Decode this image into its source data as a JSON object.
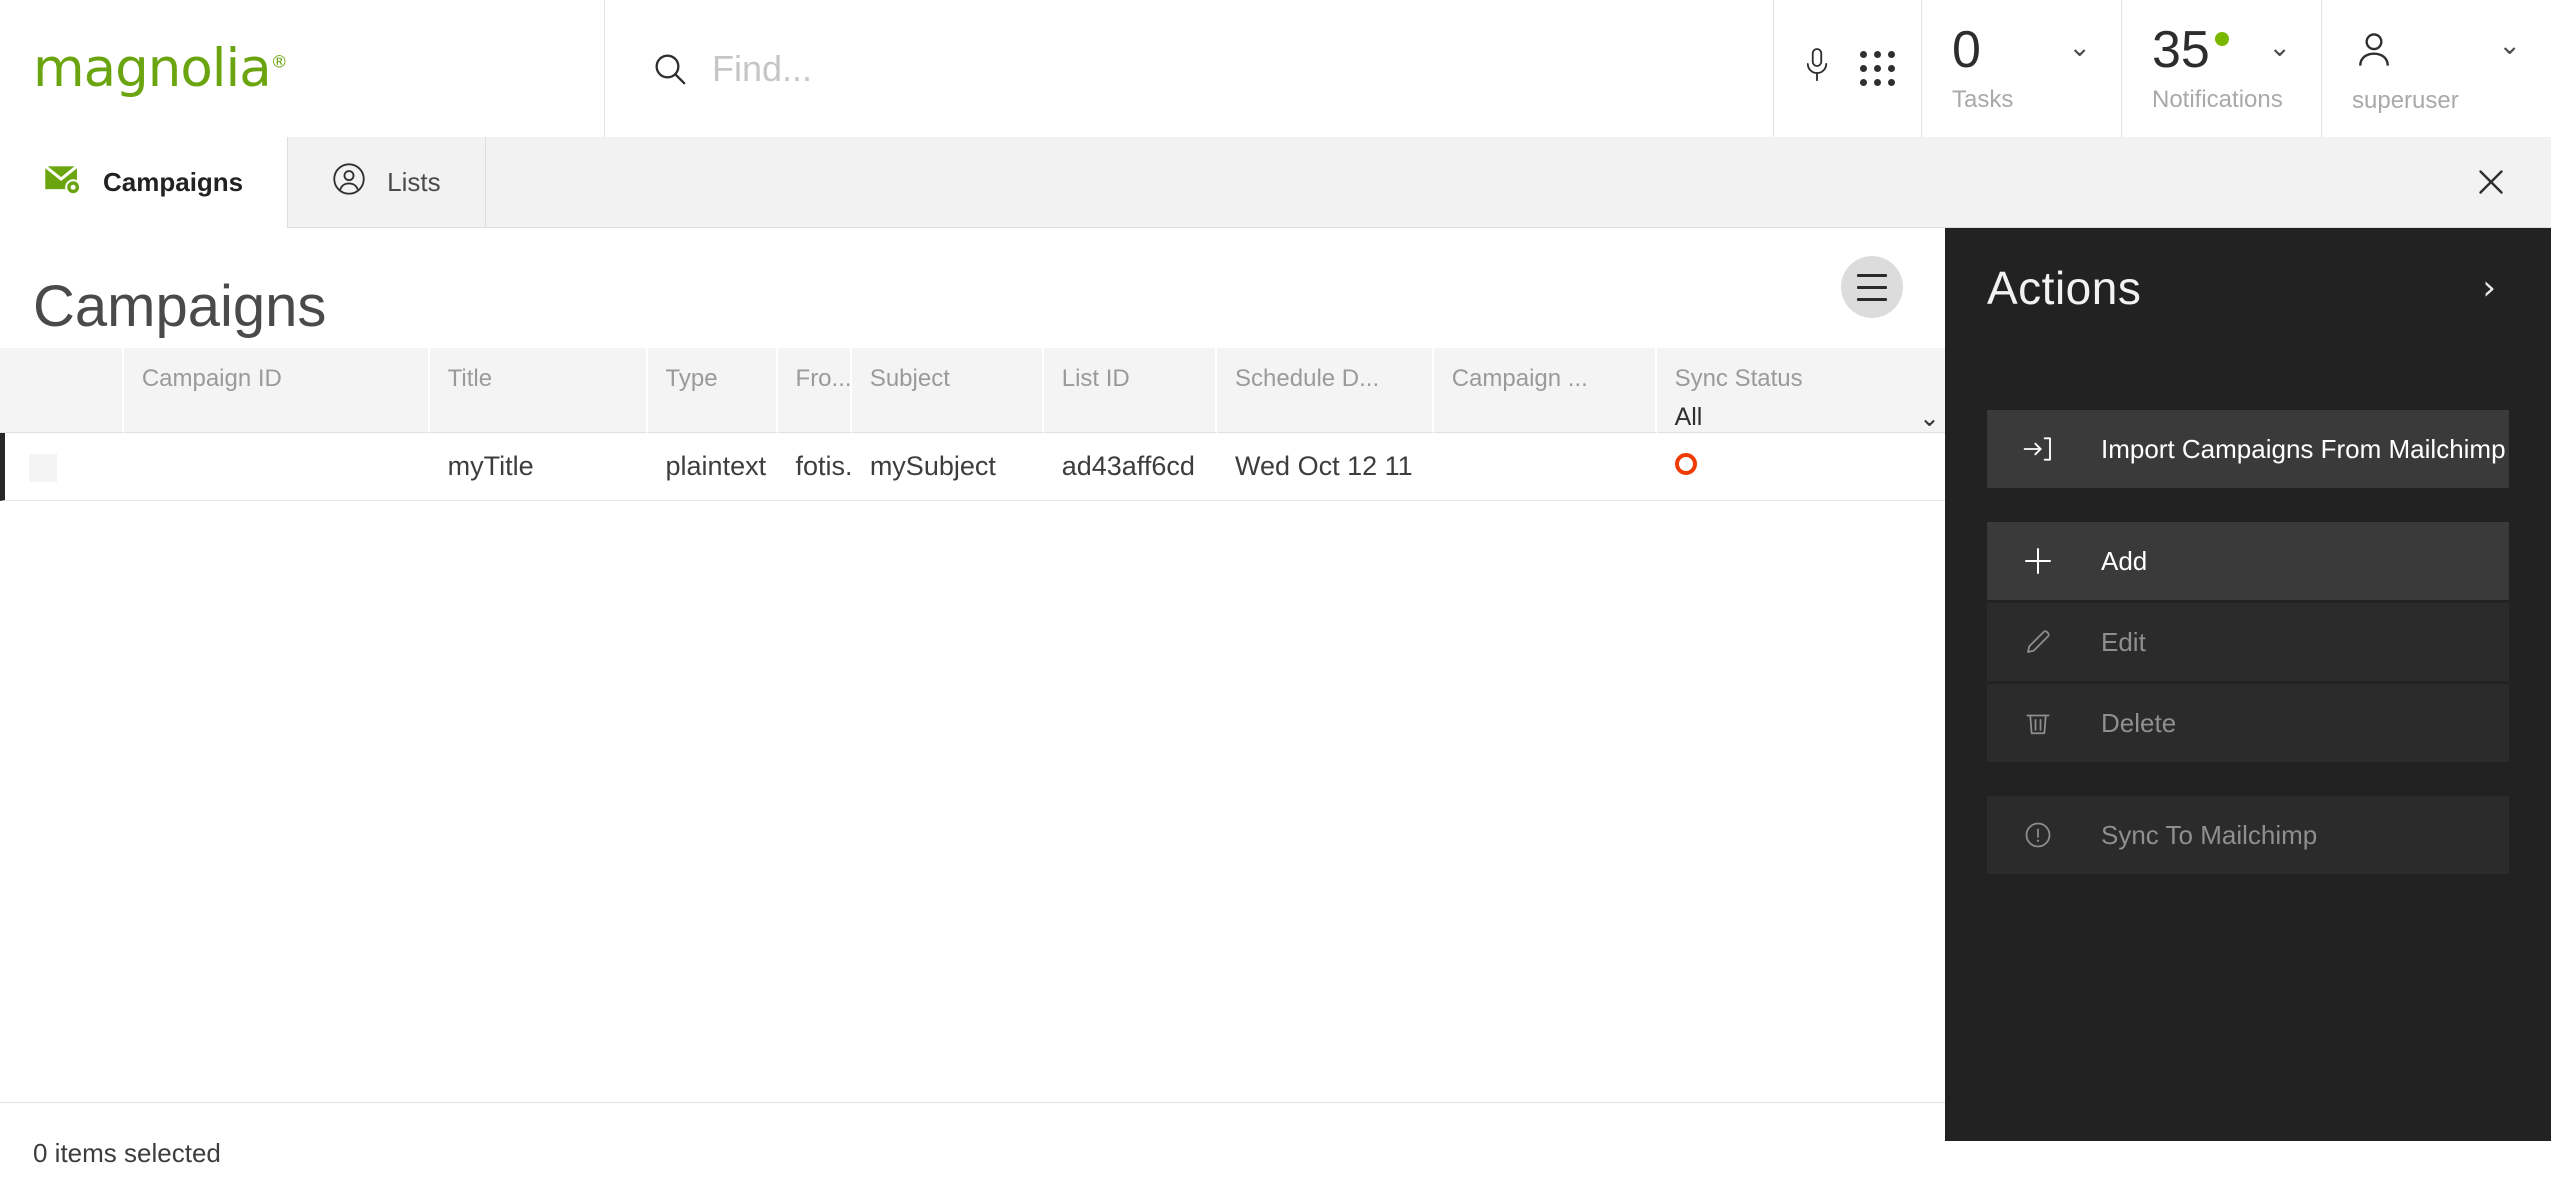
{
  "brand": {
    "name": "magnolia",
    "registered": "®",
    "color": "#6aa50f"
  },
  "search": {
    "placeholder": "Find...",
    "icon": "search-icon"
  },
  "header": {
    "mic_icon": "microphone-icon",
    "apps_icon": "apps-grid-icon",
    "tasks": {
      "count": "0",
      "label": "Tasks",
      "chevron": "⌄"
    },
    "notifications": {
      "count": "35",
      "label": "Notifications",
      "chevron": "⌄",
      "dot_color": "#7ab800"
    },
    "user": {
      "name": "superuser",
      "icon": "user-icon",
      "chevron": "⌄"
    }
  },
  "tabs": [
    {
      "label": "Campaigns",
      "icon": "mail-gear-icon",
      "active": true
    },
    {
      "label": "Lists",
      "icon": "user-circle-icon",
      "active": false
    }
  ],
  "tabbar": {
    "close_icon": "close-icon"
  },
  "page": {
    "title": "Campaigns",
    "viewmode_icon": "hamburger-icon"
  },
  "table": {
    "columns": [
      {
        "key": "check",
        "label": ""
      },
      {
        "key": "campaign_id",
        "label": "Campaign ID"
      },
      {
        "key": "title",
        "label": "Title"
      },
      {
        "key": "type",
        "label": "Type"
      },
      {
        "key": "from",
        "label": "Fro..."
      },
      {
        "key": "subject",
        "label": "Subject"
      },
      {
        "key": "list_id",
        "label": "List ID"
      },
      {
        "key": "schedule_date",
        "label": "Schedule D..."
      },
      {
        "key": "campaign_x",
        "label": "Campaign ..."
      },
      {
        "key": "sync_status",
        "label": "Sync Status"
      }
    ],
    "sync_status_filter": {
      "value": "All",
      "chevron": "⌄"
    },
    "rows": [
      {
        "check": "",
        "campaign_id": "",
        "title": "myTitle",
        "type": "plaintext",
        "from": "fotis.flc",
        "subject": "mySubject",
        "list_id": "ad43aff6cd",
        "schedule_date": "Wed Oct 12 11",
        "campaign_x": "",
        "sync_status_icon": "sync-pending-ring-icon",
        "sync_status_color": "#f03c02"
      }
    ]
  },
  "footer": {
    "status": "0 items selected"
  },
  "actions": {
    "title": "Actions",
    "collapse_chevron": "›",
    "groups": [
      {
        "items": [
          {
            "label": "Import Campaigns From Mailchimp",
            "icon": "import-arrow-icon",
            "enabled": true
          }
        ]
      },
      {
        "items": [
          {
            "label": "Add",
            "icon": "plus-icon",
            "enabled": true
          },
          {
            "label": "Edit",
            "icon": "pencil-icon",
            "enabled": false
          },
          {
            "label": "Delete",
            "icon": "trash-icon",
            "enabled": false
          }
        ]
      },
      {
        "items": [
          {
            "label": "Sync To Mailchimp",
            "icon": "info-circle-icon",
            "enabled": false
          }
        ]
      }
    ]
  }
}
